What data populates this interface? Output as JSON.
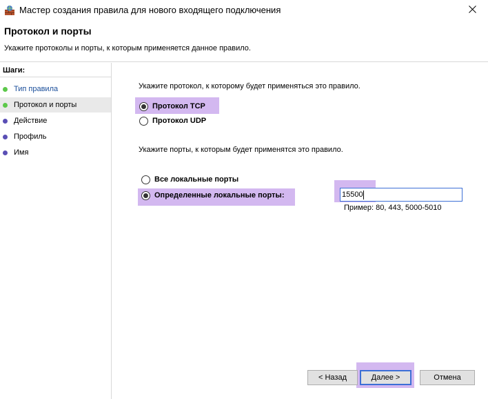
{
  "window": {
    "title": "Мастер создания правила для нового входящего подключения"
  },
  "header": {
    "title": "Протокол и порты",
    "description": "Укажите протоколы и порты, к которым применяется данное правило."
  },
  "steps": {
    "title": "Шаги:",
    "items": [
      {
        "label": "Тип правила",
        "state": "done"
      },
      {
        "label": "Протокол и порты",
        "state": "current"
      },
      {
        "label": "Действие",
        "state": "todo"
      },
      {
        "label": "Профиль",
        "state": "todo"
      },
      {
        "label": "Имя",
        "state": "todo"
      }
    ]
  },
  "protocol": {
    "prompt": "Укажите протокол, к которому будет применяться это правило.",
    "tcp_label": "Протокол TCP",
    "udp_label": "Протокол UDP",
    "selected": "tcp"
  },
  "ports": {
    "prompt": "Укажите порты, к которым будет применятся это правило.",
    "all_label": "Все локальные порты",
    "specific_label": "Определенные локальные порты:",
    "selected": "specific",
    "value": "15500",
    "example": "Пример: 80, 443, 5000-5010"
  },
  "buttons": {
    "back": "< Назад",
    "next": "Далее >",
    "cancel": "Отмена"
  },
  "colors": {
    "highlight": "#d3b8f0",
    "step_done": "#5cc84a",
    "step_todo": "#5a4fb5",
    "focus": "#3c6fd6"
  }
}
